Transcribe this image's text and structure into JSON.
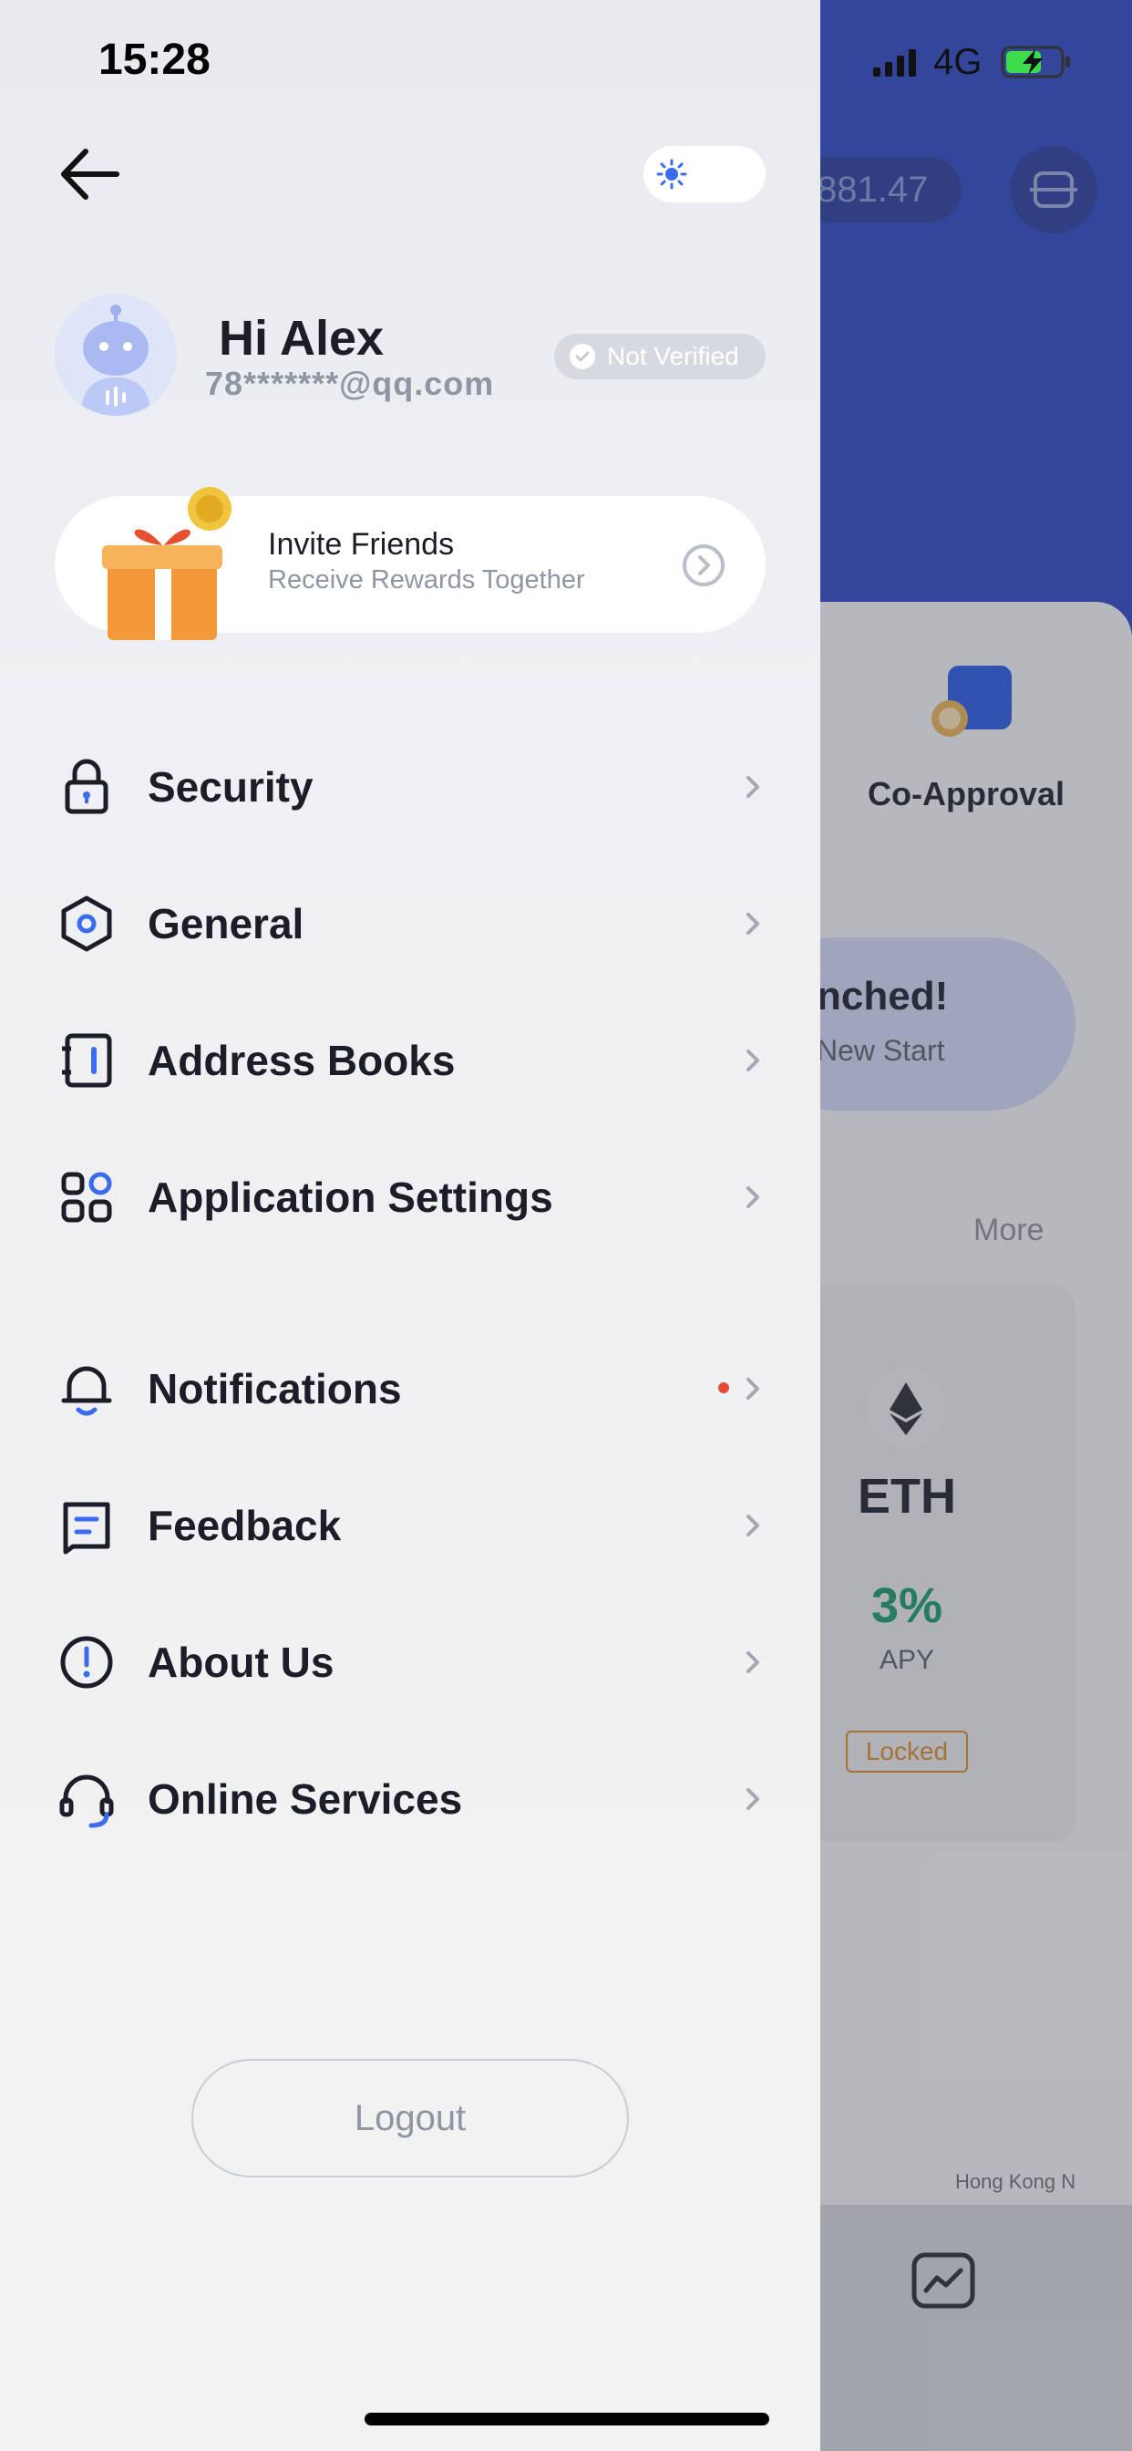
{
  "status_bar": {
    "time": "15:28",
    "network": "4G"
  },
  "background_app": {
    "balance": "881.47",
    "co_approval_label": "Co-Approval",
    "banner_title": "nched!",
    "banner_subtitle": "New Start",
    "more_label": "More",
    "eth_symbol": "ETH",
    "apy_value": "3%",
    "apy_label": "APY",
    "locked_label": "Locked",
    "footer_text": "Hong Kong N"
  },
  "drawer": {
    "greeting": "Hi Alex",
    "email": "78*******@qq.com",
    "verification": "Not Verified",
    "invite": {
      "title": "Invite Friends",
      "subtitle": "Receive Rewards Together"
    },
    "menu_group_1": [
      {
        "label": "Security",
        "icon": "lock-icon"
      },
      {
        "label": "General",
        "icon": "hexagon-settings-icon"
      },
      {
        "label": "Address Books",
        "icon": "address-book-icon"
      },
      {
        "label": "Application Settings",
        "icon": "apps-grid-icon"
      }
    ],
    "menu_group_2": [
      {
        "label": "Notifications",
        "icon": "bell-icon",
        "has_dot": true
      },
      {
        "label": "Feedback",
        "icon": "feedback-icon"
      },
      {
        "label": "About Us",
        "icon": "info-icon"
      },
      {
        "label": "Online Services",
        "icon": "headset-icon"
      }
    ],
    "logout_label": "Logout"
  },
  "colors": {
    "accent": "#3b6cf0",
    "notification_dot": "#e84a3a",
    "background_blue": "#2f49c5"
  }
}
